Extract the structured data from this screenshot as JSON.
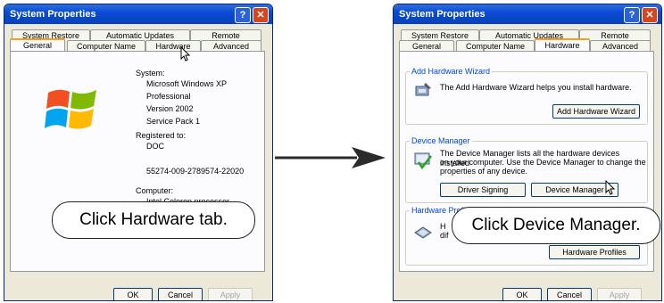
{
  "left": {
    "title": "System Properties",
    "tabs_top": [
      "System Restore",
      "Automatic Updates",
      "Remote"
    ],
    "tabs_bottom": [
      "General",
      "Computer Name",
      "Hardware",
      "Advanced"
    ],
    "system_label": "System:",
    "system_lines": [
      "Microsoft Windows XP",
      "Professional",
      "Version 2002",
      "Service Pack 1"
    ],
    "registered_label": "Registered to:",
    "registered_name": "DOC",
    "product_id": "55274-009-2789574-22020",
    "computer_label": "Computer:",
    "computer_value": "Intel Celeron processor",
    "callout": "Click Hardware tab.",
    "buttons": [
      "OK",
      "Cancel",
      "Apply"
    ]
  },
  "right": {
    "title": "System Properties",
    "tabs_top": [
      "System Restore",
      "Automatic Updates",
      "Remote"
    ],
    "tabs_bottom": [
      "General",
      "Computer Name",
      "Hardware",
      "Advanced"
    ],
    "wizard_group": "Add Hardware Wizard",
    "wizard_text": "The Add Hardware Wizard helps you install hardware.",
    "wizard_button": "Add Hardware Wizard",
    "dm_group": "Device Manager",
    "dm_text_1": "The Device Manager lists all the hardware devices installed",
    "dm_text_2": "on your computer. Use the Device Manager to change the",
    "dm_text_3": "properties of any device.",
    "driver_signing": "Driver Signing",
    "device_manager": "Device Manager",
    "profiles_group": "Hardware Profi",
    "profiles_text_1": "H",
    "profiles_text_2": "dif",
    "profiles_button": "Hardware Profiles",
    "callout": "Click Device Manager.",
    "buttons": [
      "OK",
      "Cancel",
      "Apply"
    ]
  }
}
